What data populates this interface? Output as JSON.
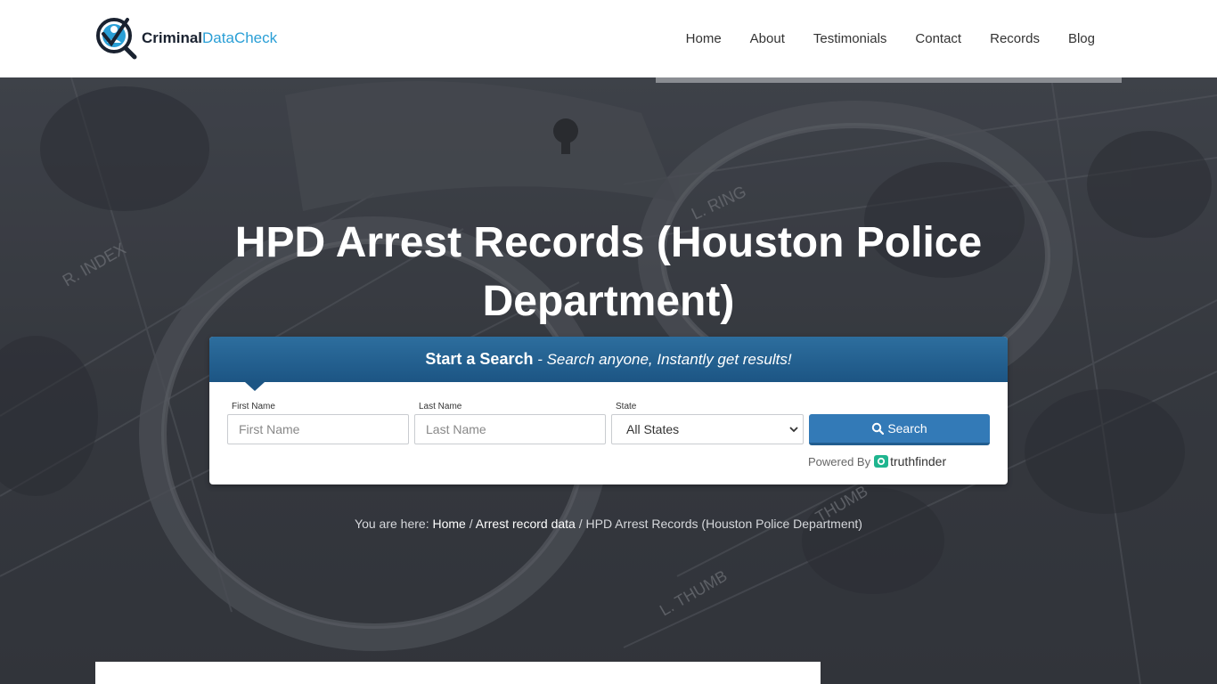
{
  "brand": {
    "word1": "Criminal",
    "word2": "DataCheck",
    "colors": {
      "dark": "#1a2230",
      "accent": "#2a9fd6"
    }
  },
  "nav": {
    "items": [
      {
        "label": "Home"
      },
      {
        "label": "About"
      },
      {
        "label": "Testimonials"
      },
      {
        "label": "Contact"
      },
      {
        "label": "Records"
      },
      {
        "label": "Blog"
      }
    ]
  },
  "hero": {
    "title": "HPD Arrest Records (Houston Police Department)"
  },
  "search": {
    "heading_strong": "Start a Search",
    "heading_sub": " - Search anyone, Instantly get results!",
    "first_name": {
      "label": "First Name",
      "placeholder": "First Name"
    },
    "last_name": {
      "label": "Last Name",
      "placeholder": "Last Name"
    },
    "state": {
      "label": "State",
      "selected": "All States"
    },
    "button_label": "Search",
    "powered_by": "Powered By",
    "provider": "truthfinder",
    "colors": {
      "header": "#1c5584",
      "button": "#337ab7"
    }
  },
  "breadcrumb": {
    "prefix": "You are here: ",
    "home": "Home",
    "sep1": " / ",
    "section": "Arrest record data",
    "sep2": " / ",
    "current": "HPD Arrest Records (Houston Police Department)"
  }
}
